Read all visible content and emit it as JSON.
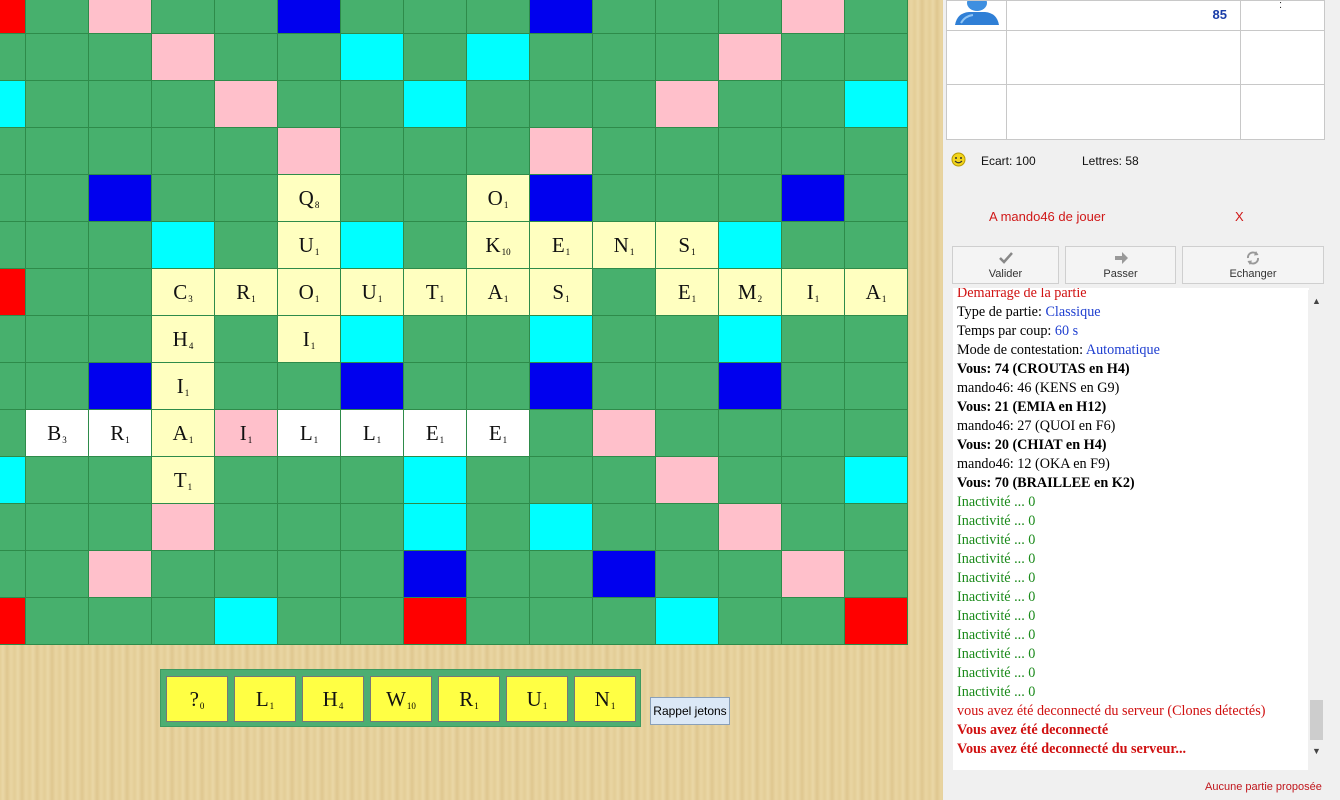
{
  "colors": {
    "green": "#47b06d",
    "pink": "#ffc0cb",
    "cyan": "#00ffff",
    "blue": "#0000ee",
    "red": "#ff0000",
    "tile_placed": "#ffffc0",
    "tile_new": "#ffffff",
    "rack_tile": "#ffff44"
  },
  "board": {
    "premium_rows": [
      "GWGGBGGGBGGGWG",
      "GGWGGCGCGGGWGG",
      "CGGWGGCGGGWGGC",
      "GGGGWGGGGWGGGG",
      "GBGGGQGGOBGGBG",
      "GGCGGUCGKENSCG",
      "RGGCROUTAS.EMIA",
      "GGCHGICGCGGCGG",
      "GBGIGBGGBGGBGG",
      "BRAIL LEE W G G G",
      "CGGTGGCGGGWGGC",
      "GGWGGGCGCGGGWG",
      "GWGGGGBGGBGGGWG",
      "RGGCGGRGGGCGGR"
    ],
    "tiles": [
      {
        "letter": "Q",
        "value": "8",
        "row": 4,
        "col": 5,
        "state": "placed"
      },
      {
        "letter": "O",
        "value": "1",
        "row": 4,
        "col": 8,
        "state": "placed"
      },
      {
        "letter": "U",
        "value": "1",
        "row": 5,
        "col": 5,
        "state": "placed"
      },
      {
        "letter": "K",
        "value": "10",
        "row": 5,
        "col": 8,
        "state": "placed"
      },
      {
        "letter": "E",
        "value": "1",
        "row": 5,
        "col": 9,
        "state": "placed"
      },
      {
        "letter": "N",
        "value": "1",
        "row": 5,
        "col": 10,
        "state": "placed"
      },
      {
        "letter": "S",
        "value": "1",
        "row": 5,
        "col": 11,
        "state": "placed"
      },
      {
        "letter": "C",
        "value": "3",
        "row": 6,
        "col": 3,
        "state": "placed"
      },
      {
        "letter": "R",
        "value": "1",
        "row": 6,
        "col": 4,
        "state": "placed"
      },
      {
        "letter": "O",
        "value": "1",
        "row": 6,
        "col": 5,
        "state": "placed"
      },
      {
        "letter": "U",
        "value": "1",
        "row": 6,
        "col": 6,
        "state": "placed"
      },
      {
        "letter": "T",
        "value": "1",
        "row": 6,
        "col": 7,
        "state": "placed"
      },
      {
        "letter": "A",
        "value": "1",
        "row": 6,
        "col": 8,
        "state": "placed"
      },
      {
        "letter": "S",
        "value": "1",
        "row": 6,
        "col": 9,
        "state": "placed"
      },
      {
        "letter": "E",
        "value": "1",
        "row": 6,
        "col": 11,
        "state": "placed"
      },
      {
        "letter": "M",
        "value": "2",
        "row": 6,
        "col": 12,
        "state": "placed"
      },
      {
        "letter": "I",
        "value": "1",
        "row": 6,
        "col": 13,
        "state": "placed"
      },
      {
        "letter": "A",
        "value": "1",
        "row": 6,
        "col": 14,
        "state": "placed"
      },
      {
        "letter": "H",
        "value": "4",
        "row": 7,
        "col": 3,
        "state": "placed"
      },
      {
        "letter": "I",
        "value": "1",
        "row": 7,
        "col": 5,
        "state": "placed"
      },
      {
        "letter": "I",
        "value": "1",
        "row": 8,
        "col": 3,
        "state": "placed"
      },
      {
        "letter": "B",
        "value": "3",
        "row": 9,
        "col": 1,
        "state": "new"
      },
      {
        "letter": "R",
        "value": "1",
        "row": 9,
        "col": 2,
        "state": "new"
      },
      {
        "letter": "A",
        "value": "1",
        "row": 9,
        "col": 3,
        "state": "placed"
      },
      {
        "letter": "I",
        "value": "1",
        "row": 9,
        "col": 4,
        "state": "new-pink"
      },
      {
        "letter": "L",
        "value": "1",
        "row": 9,
        "col": 5,
        "state": "new"
      },
      {
        "letter": "L",
        "value": "1",
        "row": 9,
        "col": 6,
        "state": "new"
      },
      {
        "letter": "E",
        "value": "1",
        "row": 9,
        "col": 7,
        "state": "new"
      },
      {
        "letter": "E",
        "value": "1",
        "row": 9,
        "col": 8,
        "state": "new"
      },
      {
        "letter": "T",
        "value": "1",
        "row": 10,
        "col": 3,
        "state": "placed"
      }
    ]
  },
  "rack": {
    "tiles": [
      {
        "letter": "?",
        "value": "0"
      },
      {
        "letter": "L",
        "value": "1"
      },
      {
        "letter": "H",
        "value": "4"
      },
      {
        "letter": "W",
        "value": "10"
      },
      {
        "letter": "R",
        "value": "1"
      },
      {
        "letter": "U",
        "value": "1"
      },
      {
        "letter": "N",
        "value": "1"
      }
    ],
    "recall_label": "Rappel jetons"
  },
  "scores": {
    "opponent_score": "85",
    "colon": ":"
  },
  "stats": {
    "ecart": "Ecart: 100",
    "lettres": "Lettres: 58"
  },
  "turn": {
    "message": "A mando46 de jouer",
    "close": "X"
  },
  "actions": {
    "validate": "Valider",
    "pass": "Passer",
    "exchange": "Echanger"
  },
  "log": [
    {
      "text": "Demarrage de la partie",
      "style": "red"
    },
    {
      "label": "Type de partie: ",
      "value": "Classique",
      "style": "kv"
    },
    {
      "label": "Temps par coup: ",
      "value": "60 s",
      "style": "kv"
    },
    {
      "label": "Mode de contestation: ",
      "value": "Automatique",
      "style": "kv"
    },
    {
      "text": "Vous: 74 (CROUTAS en H4)",
      "style": "bold"
    },
    {
      "text": "mando46: 46 (KENS en G9)",
      "style": "plain"
    },
    {
      "text": "Vous: 21 (EMIA en H12)",
      "style": "bold"
    },
    {
      "text": "mando46: 27 (QUOI en F6)",
      "style": "plain"
    },
    {
      "text": "Vous: 20 (CHIAT en H4)",
      "style": "bold"
    },
    {
      "text": "mando46: 12 (OKA en F9)",
      "style": "plain"
    },
    {
      "text": "Vous: 70 (BRAILLEE en K2)",
      "style": "bold"
    },
    {
      "text": "Inactivité ... 0",
      "style": "green"
    },
    {
      "text": "Inactivité ... 0",
      "style": "green"
    },
    {
      "text": "Inactivité ... 0",
      "style": "green"
    },
    {
      "text": "Inactivité ... 0",
      "style": "green"
    },
    {
      "text": "Inactivité ... 0",
      "style": "green"
    },
    {
      "text": "Inactivité ... 0",
      "style": "green"
    },
    {
      "text": "Inactivité ... 0",
      "style": "green"
    },
    {
      "text": "Inactivité ... 0",
      "style": "green"
    },
    {
      "text": "Inactivité ... 0",
      "style": "green"
    },
    {
      "text": "Inactivité ... 0",
      "style": "green"
    },
    {
      "text": "Inactivité ... 0",
      "style": "green"
    },
    {
      "text": "vous avez été deconnecté du serveur (Clones détectés)",
      "style": "red"
    },
    {
      "text": "Vous avez été deconnecté",
      "style": "redbold"
    },
    {
      "text": "Vous avez été deconnecté du serveur...",
      "style": "redbold"
    }
  ],
  "footer": "Aucune partie proposée"
}
